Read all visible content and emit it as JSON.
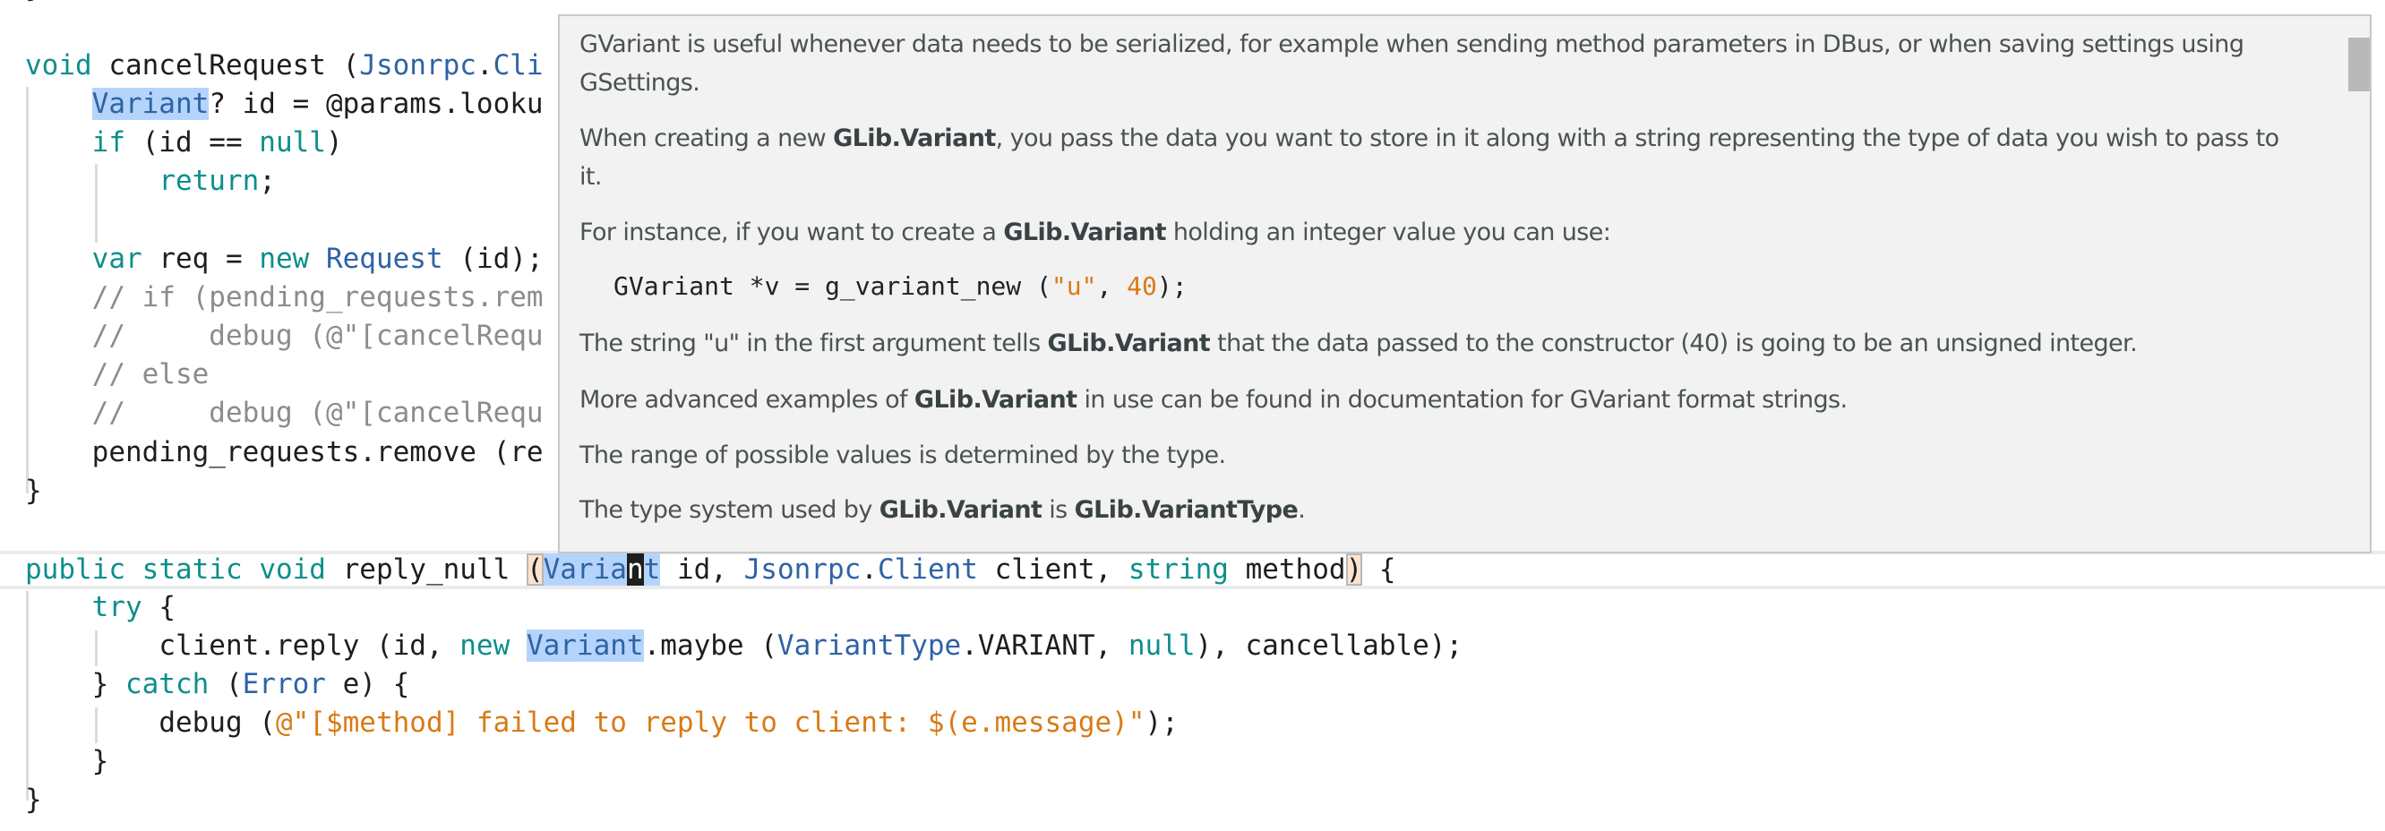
{
  "editor": {
    "lines": {
      "l_top": "}",
      "l0": {
        "kw": "void",
        "name": " cancelRequest (",
        "ty1": "Jsonrpc",
        "dot": ".",
        "ty2": "Cli"
      },
      "l1": {
        "ty": "Variant",
        "rest": "? id = @params.looku"
      },
      "l2": {
        "kw": "if",
        "a": " (id == ",
        "kw2": "null",
        "b": ")"
      },
      "l3": {
        "kw": "return",
        "rest": ";"
      },
      "l5": {
        "kw": "var",
        "a": " req = ",
        "kw2": "new",
        "sp": " ",
        "ty": "Request",
        "b": " (id);"
      },
      "l6": "// if (pending_requests.rem",
      "l7": "//     debug (@\"[cancelRequ",
      "l8": "// else",
      "l9": "//     debug (@\"[cancelRequ",
      "l10": "pending_requests.remove (re",
      "l11": "}",
      "l13": {
        "kw1": "public",
        "kw2": "static",
        "kw3": "void",
        "name": "reply_null ",
        "paren_open": "(",
        "ty_sel": "Varia",
        "cursor_char": "n",
        "ty_sel2": "t",
        "a": " id, ",
        "ty1": "Jsonrpc",
        "dot": ".",
        "ty2": "Client",
        "b": " client, ",
        "kw4": "string",
        "c": " method",
        "paren_close": ")",
        "d": " {"
      },
      "l14": {
        "kw": "try",
        "rest": " {"
      },
      "l15": {
        "a": "client.reply (id, ",
        "kw": "new",
        "sp": " ",
        "ty": "Variant",
        "b": ".maybe (",
        "ty2": "VariantType",
        "c": ".VARIANT, ",
        "kw2": "null",
        "d": "), cancellable);"
      },
      "l16": {
        "a": "} ",
        "kw": "catch",
        "b": " (",
        "ty": "Error",
        "c": " e) {"
      },
      "l17": {
        "a": "debug (",
        "str": "@\"[$method] failed to reply to client: $(e.message)\"",
        "b": ");"
      },
      "l18": "}",
      "l19": "}"
    }
  },
  "popup": {
    "p1_line1": "GVariant is useful whenever data needs to be serialized, for example when sending method parameters in DBus, or when saving settings using",
    "p1_line2": "GSettings.",
    "p2_a": "When creating a new ",
    "p2_b": "GLib.Variant",
    "p2_c": ", you pass the data you want to store in it along with a string representing the type of data you wish to pass to",
    "p2_line2": "it.",
    "p3_a": "For instance, if you want to create a ",
    "p3_b": "GLib.Variant",
    "p3_c": " holding an integer value you can use:",
    "code_a": "GVariant *v = g_variant_new (",
    "code_str": "\"u\"",
    "code_b": ", ",
    "code_num": "40",
    "code_c": ");",
    "p4_a": "The string \"u\" in the first argument tells ",
    "p4_b": "GLib.Variant",
    "p4_c": " that the data passed to the constructor (40) is going to be an unsigned integer.",
    "p5_a": "More advanced examples of ",
    "p5_b": "GLib.Variant",
    "p5_c": " in use can be found in documentation for GVariant format strings.",
    "p6": "The range of possible values is determined by the type.",
    "p7_a": "The type system used by ",
    "p7_b": "GLib.Variant",
    "p7_c": " is ",
    "p7_d": "GLib.VariantType",
    "p7_e": "."
  },
  "colors": {
    "keyword": "#0e8f8c",
    "type": "#2f62a6",
    "comment": "#8c8c8c",
    "string": "#d97a16",
    "selection": "#b5d4fb",
    "popup_bg": "#f2f2f2"
  }
}
